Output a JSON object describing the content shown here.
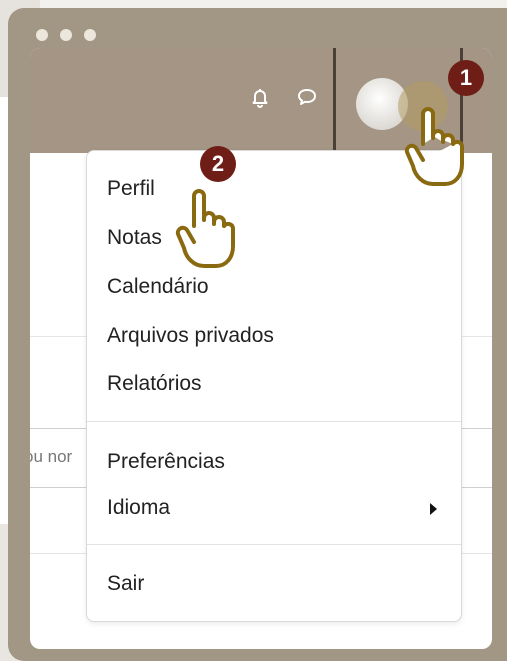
{
  "menu": {
    "items": [
      {
        "label": "Perfil",
        "highlighted": true
      },
      {
        "label": "Notas"
      },
      {
        "label": "Calendário"
      },
      {
        "label": "Arquivos privados"
      },
      {
        "label": "Relatórios"
      },
      {
        "label": "Preferências"
      },
      {
        "label": "Idioma",
        "submenu": true
      },
      {
        "label": "Sair"
      }
    ]
  },
  "page": {
    "search_fragment": "ou nor"
  },
  "annotations": {
    "step1": "1",
    "step2": "2"
  },
  "colors": {
    "frame": "#a29684",
    "navbar": "#a49584",
    "highlight": "#d9ccb0",
    "badge": "#6e1d17",
    "hand": "#8a6a10"
  },
  "icons": {
    "notifications": "bell-icon",
    "messages": "chat-bubble-icon",
    "user_menu": "chevron-down-icon",
    "pointer": "hand-pointer-icon"
  }
}
